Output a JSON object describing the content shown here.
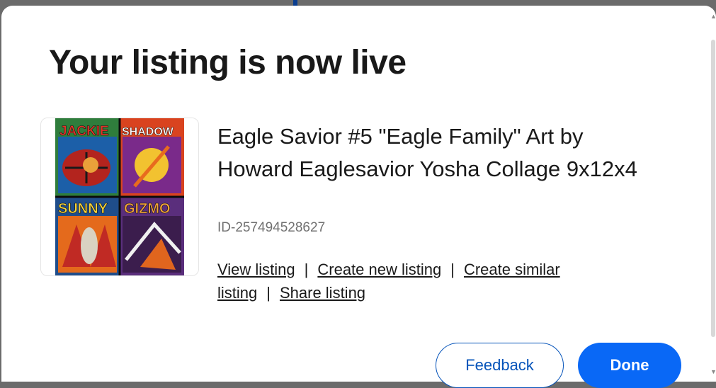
{
  "dialog": {
    "title": "Your listing is now live"
  },
  "listing": {
    "title": "Eagle Savior #5 \"Eagle Family\" Art by Howard Eaglesavior Yosha Collage 9x12x4",
    "id": "ID-257494528627",
    "thumbnail_labels": [
      "JACKIE",
      "SHADOW",
      "SUNNY",
      "GIZMO"
    ]
  },
  "links": {
    "view": "View listing",
    "create_new": "Create new listing",
    "create_similar": "Create similar listing",
    "share": "Share listing",
    "separator": "|"
  },
  "buttons": {
    "feedback": "Feedback",
    "done": "Done"
  },
  "colors": {
    "accent": "#0968f6",
    "feedback_outline": "#0654ba"
  }
}
